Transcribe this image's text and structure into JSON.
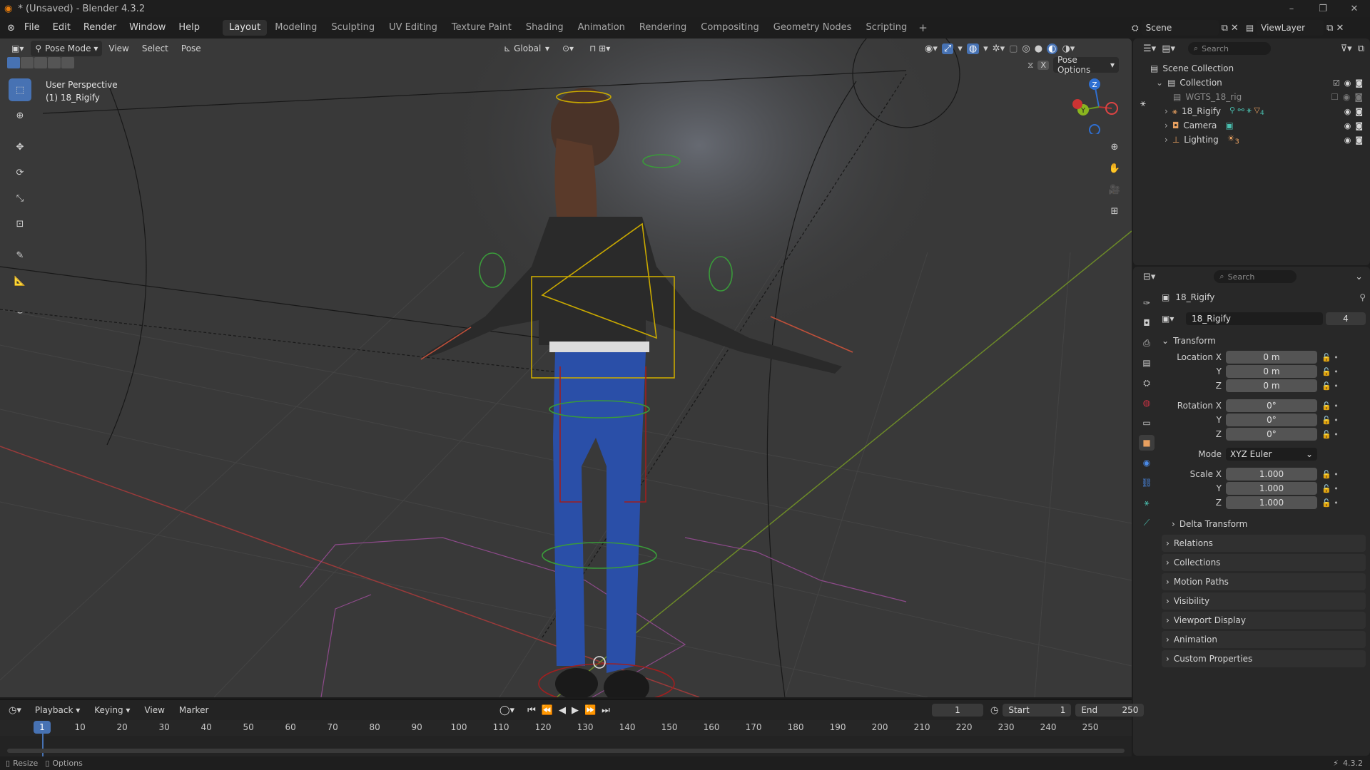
{
  "window": {
    "title": "* (Unsaved) - Blender 4.3.2"
  },
  "menubar": {
    "menus": [
      "File",
      "Edit",
      "Render",
      "Window",
      "Help"
    ],
    "workspaces": [
      "Layout",
      "Modeling",
      "Sculpting",
      "UV Editing",
      "Texture Paint",
      "Shading",
      "Animation",
      "Rendering",
      "Compositing",
      "Geometry Nodes",
      "Scripting"
    ],
    "active_workspace": "Layout",
    "scene": "Scene",
    "view_layer": "ViewLayer"
  },
  "viewport_header": {
    "mode": "Pose Mode",
    "menus": [
      "View",
      "Select",
      "Pose"
    ],
    "transform_orientation": "Global",
    "pose_options": "Pose Options"
  },
  "viewport": {
    "perspective": "User Perspective",
    "object_info": "(1) 18_Rigify",
    "gizmo_axes": [
      "Z",
      "Y"
    ]
  },
  "outliner": {
    "search_placeholder": "Search",
    "root": "Scene Collection",
    "collection": "Collection",
    "items": [
      {
        "name": "WGTS_18_rig",
        "icon": "collection-icon"
      },
      {
        "name": "18_Rigify",
        "icon": "armature-icon",
        "badge": "4"
      },
      {
        "name": "Camera",
        "icon": "camera-icon"
      },
      {
        "name": "Lighting",
        "icon": "light-icon",
        "badge": "3"
      }
    ]
  },
  "properties": {
    "search_placeholder": "Search",
    "object_name": "18_Rigify",
    "data_name": "18_Rigify",
    "users": "4",
    "transform": {
      "title": "Transform",
      "location_label": "Location X",
      "location": [
        "0 m",
        "0 m",
        "0 m"
      ],
      "rotation_label": "Rotation X",
      "rotation": [
        "0°",
        "0°",
        "0°"
      ],
      "mode_label": "Mode",
      "mode": "XYZ Euler",
      "scale_label": "Scale X",
      "scale": [
        "1.000",
        "1.000",
        "1.000"
      ],
      "y_label": "Y",
      "z_label": "Z"
    },
    "delta_transform": "Delta Transform",
    "panels": [
      "Relations",
      "Collections",
      "Motion Paths",
      "Visibility",
      "Viewport Display",
      "Animation",
      "Custom Properties"
    ]
  },
  "timeline": {
    "menus": [
      "Playback",
      "Keying",
      "View",
      "Marker"
    ],
    "current_frame": "1",
    "start_label": "Start",
    "start": "1",
    "end_label": "End",
    "end": "250",
    "ticks": [
      "10",
      "20",
      "30",
      "40",
      "50",
      "60",
      "70",
      "80",
      "90",
      "100",
      "110",
      "120",
      "130",
      "140",
      "150",
      "160",
      "170",
      "180",
      "190",
      "200",
      "210",
      "220",
      "230",
      "240",
      "250"
    ],
    "playhead": "1"
  },
  "statusbar": {
    "left1": "Resize",
    "left2": "Options",
    "version": "4.3.2"
  }
}
